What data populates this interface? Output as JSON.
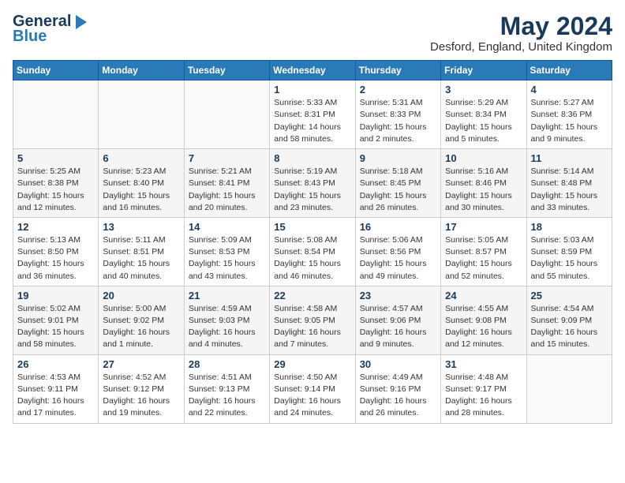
{
  "header": {
    "logo_line1": "General",
    "logo_line2": "Blue",
    "month_title": "May 2024",
    "location": "Desford, England, United Kingdom"
  },
  "days_of_week": [
    "Sunday",
    "Monday",
    "Tuesday",
    "Wednesday",
    "Thursday",
    "Friday",
    "Saturday"
  ],
  "weeks": [
    [
      {
        "day": "",
        "info": ""
      },
      {
        "day": "",
        "info": ""
      },
      {
        "day": "",
        "info": ""
      },
      {
        "day": "1",
        "info": "Sunrise: 5:33 AM\nSunset: 8:31 PM\nDaylight: 14 hours\nand 58 minutes."
      },
      {
        "day": "2",
        "info": "Sunrise: 5:31 AM\nSunset: 8:33 PM\nDaylight: 15 hours\nand 2 minutes."
      },
      {
        "day": "3",
        "info": "Sunrise: 5:29 AM\nSunset: 8:34 PM\nDaylight: 15 hours\nand 5 minutes."
      },
      {
        "day": "4",
        "info": "Sunrise: 5:27 AM\nSunset: 8:36 PM\nDaylight: 15 hours\nand 9 minutes."
      }
    ],
    [
      {
        "day": "5",
        "info": "Sunrise: 5:25 AM\nSunset: 8:38 PM\nDaylight: 15 hours\nand 12 minutes."
      },
      {
        "day": "6",
        "info": "Sunrise: 5:23 AM\nSunset: 8:40 PM\nDaylight: 15 hours\nand 16 minutes."
      },
      {
        "day": "7",
        "info": "Sunrise: 5:21 AM\nSunset: 8:41 PM\nDaylight: 15 hours\nand 20 minutes."
      },
      {
        "day": "8",
        "info": "Sunrise: 5:19 AM\nSunset: 8:43 PM\nDaylight: 15 hours\nand 23 minutes."
      },
      {
        "day": "9",
        "info": "Sunrise: 5:18 AM\nSunset: 8:45 PM\nDaylight: 15 hours\nand 26 minutes."
      },
      {
        "day": "10",
        "info": "Sunrise: 5:16 AM\nSunset: 8:46 PM\nDaylight: 15 hours\nand 30 minutes."
      },
      {
        "day": "11",
        "info": "Sunrise: 5:14 AM\nSunset: 8:48 PM\nDaylight: 15 hours\nand 33 minutes."
      }
    ],
    [
      {
        "day": "12",
        "info": "Sunrise: 5:13 AM\nSunset: 8:50 PM\nDaylight: 15 hours\nand 36 minutes."
      },
      {
        "day": "13",
        "info": "Sunrise: 5:11 AM\nSunset: 8:51 PM\nDaylight: 15 hours\nand 40 minutes."
      },
      {
        "day": "14",
        "info": "Sunrise: 5:09 AM\nSunset: 8:53 PM\nDaylight: 15 hours\nand 43 minutes."
      },
      {
        "day": "15",
        "info": "Sunrise: 5:08 AM\nSunset: 8:54 PM\nDaylight: 15 hours\nand 46 minutes."
      },
      {
        "day": "16",
        "info": "Sunrise: 5:06 AM\nSunset: 8:56 PM\nDaylight: 15 hours\nand 49 minutes."
      },
      {
        "day": "17",
        "info": "Sunrise: 5:05 AM\nSunset: 8:57 PM\nDaylight: 15 hours\nand 52 minutes."
      },
      {
        "day": "18",
        "info": "Sunrise: 5:03 AM\nSunset: 8:59 PM\nDaylight: 15 hours\nand 55 minutes."
      }
    ],
    [
      {
        "day": "19",
        "info": "Sunrise: 5:02 AM\nSunset: 9:01 PM\nDaylight: 15 hours\nand 58 minutes."
      },
      {
        "day": "20",
        "info": "Sunrise: 5:00 AM\nSunset: 9:02 PM\nDaylight: 16 hours\nand 1 minute."
      },
      {
        "day": "21",
        "info": "Sunrise: 4:59 AM\nSunset: 9:03 PM\nDaylight: 16 hours\nand 4 minutes."
      },
      {
        "day": "22",
        "info": "Sunrise: 4:58 AM\nSunset: 9:05 PM\nDaylight: 16 hours\nand 7 minutes."
      },
      {
        "day": "23",
        "info": "Sunrise: 4:57 AM\nSunset: 9:06 PM\nDaylight: 16 hours\nand 9 minutes."
      },
      {
        "day": "24",
        "info": "Sunrise: 4:55 AM\nSunset: 9:08 PM\nDaylight: 16 hours\nand 12 minutes."
      },
      {
        "day": "25",
        "info": "Sunrise: 4:54 AM\nSunset: 9:09 PM\nDaylight: 16 hours\nand 15 minutes."
      }
    ],
    [
      {
        "day": "26",
        "info": "Sunrise: 4:53 AM\nSunset: 9:11 PM\nDaylight: 16 hours\nand 17 minutes."
      },
      {
        "day": "27",
        "info": "Sunrise: 4:52 AM\nSunset: 9:12 PM\nDaylight: 16 hours\nand 19 minutes."
      },
      {
        "day": "28",
        "info": "Sunrise: 4:51 AM\nSunset: 9:13 PM\nDaylight: 16 hours\nand 22 minutes."
      },
      {
        "day": "29",
        "info": "Sunrise: 4:50 AM\nSunset: 9:14 PM\nDaylight: 16 hours\nand 24 minutes."
      },
      {
        "day": "30",
        "info": "Sunrise: 4:49 AM\nSunset: 9:16 PM\nDaylight: 16 hours\nand 26 minutes."
      },
      {
        "day": "31",
        "info": "Sunrise: 4:48 AM\nSunset: 9:17 PM\nDaylight: 16 hours\nand 28 minutes."
      },
      {
        "day": "",
        "info": ""
      }
    ]
  ]
}
